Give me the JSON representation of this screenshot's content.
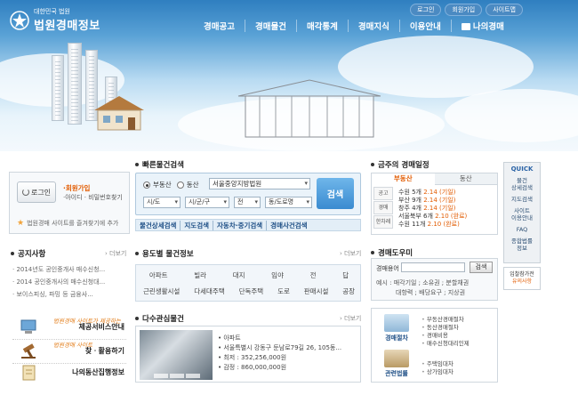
{
  "header": {
    "logo_top": "대한민국 법원",
    "logo_main": "법원경매정보",
    "util": [
      "로그인",
      "회원가입",
      "사이트맵"
    ],
    "nav": [
      "경매공고",
      "경매물건",
      "매각통계",
      "경매지식",
      "이용안내",
      "나의경매"
    ]
  },
  "login": {
    "button": "로그인",
    "join": "·회원가입",
    "find": "·아이디 · 비밀번호찾기",
    "favorite": "법원경매 사이트를 즐겨찾기에 추가"
  },
  "notice": {
    "title": "공지사항",
    "more": "› 더보기",
    "items": [
      "· 2014년도 공인중개사 매수신청...",
      "· 2014 공인중개사의 매수신청대...",
      "· 보이스피싱, 파밍 등 금융사..."
    ]
  },
  "banners": [
    {
      "label": "제공서비스안내",
      "script": "법원경매 사이트가 제공하는"
    },
    {
      "label": "찾ㆍ활용하기",
      "script": "법원경매 사이트"
    },
    {
      "label": "나의동산집행정보",
      "script": ""
    }
  ],
  "quick_search": {
    "title": "빠른물건검색",
    "radio_realestate": "부동산",
    "radio_movable": "동산",
    "court": "서울중앙지방법원",
    "sido": "시/도",
    "sigungu": "시/군/구",
    "usage": "전",
    "dong": "동/도로명",
    "button": "검색"
  },
  "quick_links": [
    "물건상세검색",
    "지도검색",
    "자동차·중기검색",
    "경매사건검색"
  ],
  "usage_info": {
    "title": "용도별 물건정보",
    "more": "› 더보기",
    "row1": [
      "아파트",
      "빌라",
      "대지",
      "임야",
      "전",
      "답"
    ],
    "row2": [
      "근린생활시설",
      "다세대주택",
      "단독주택",
      "도로",
      "판매시설",
      "공장"
    ]
  },
  "multi_interest": {
    "title": "다수관심물건",
    "more": "› 더보기",
    "type": "• 아파트",
    "address": "• 서울특별시 강동구 둔남로79길 26, 105동...",
    "min_price": "• 최저 : 352,256,000원",
    "appraisal": "• 감정 : 860,000,000원"
  },
  "schedule": {
    "title": "금주의 경매일정",
    "tabs": [
      "부동산",
      "동산"
    ],
    "side": [
      "공고",
      "경매",
      "한차례"
    ],
    "rows": [
      {
        "text": "수원 5개",
        "hl": " 2.14 (기일)"
      },
      {
        "text": "부산 9개",
        "hl": " 2.14 (기일)"
      },
      {
        "text": "창주 4개",
        "hl": " 2.14 (기일)"
      },
      {
        "text": "서울북부 6개",
        "hl": " 2.10 (완료)"
      },
      {
        "text": "수원 11개",
        "hl": " 2.10 (완료)"
      }
    ]
  },
  "dictionary": {
    "title": "경매도우미",
    "label": "경매용어",
    "button": "검색",
    "example_line1": "예시 : 매각기일 ; 소유권 ; 분할채권",
    "example_line2": "대항력 ; 배당요구 ; 지상권"
  },
  "procedures": {
    "auction_label": "경매절차",
    "auction_items": [
      "부동산경매절차",
      "동산경매절차",
      "경매비용",
      "매수신청대리인제"
    ],
    "law_label": "관련법률",
    "law_items": [
      "주택임대차",
      "상가임대차"
    ]
  },
  "quick_bar": {
    "title": "QUICK",
    "items": [
      "물건\n상세검색",
      "지도검색",
      "사이트\n이용안내",
      "FAQ",
      "종합법률\n정보"
    ],
    "caution_1": "입찰참가전",
    "caution_2": "유의사항"
  }
}
